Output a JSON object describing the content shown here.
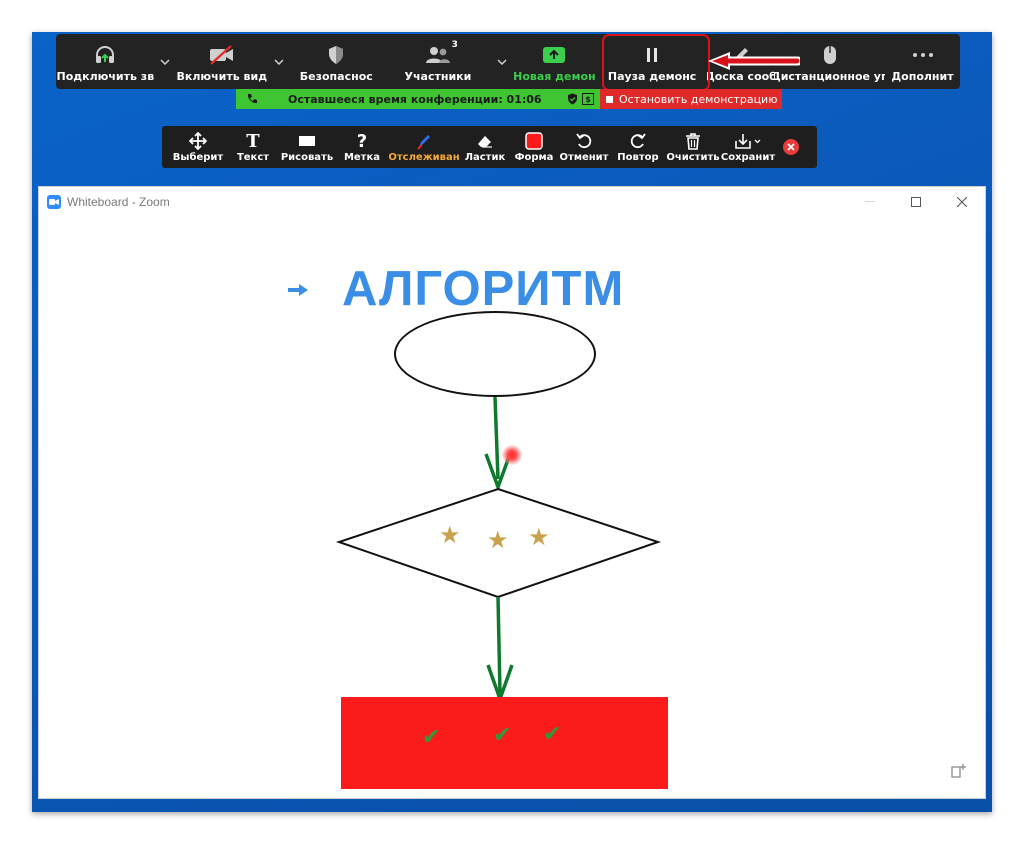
{
  "meeting_bar": {
    "items": [
      {
        "label": "Подключить зв",
        "icon": "headphones-icon"
      },
      {
        "label": "Включить вид",
        "icon": "video-off-icon"
      },
      {
        "label": "Безопаснос",
        "icon": "shield-icon"
      },
      {
        "label": "Участники",
        "icon": "participants-icon",
        "count": "3"
      },
      {
        "label": "Новая демон",
        "icon": "share-screen-icon"
      },
      {
        "label": "Пауза демонс",
        "icon": "pause-icon"
      },
      {
        "label": "Доска сооб",
        "icon": "pencil-icon"
      },
      {
        "label": "Дистанционное уп",
        "icon": "mouse-icon"
      },
      {
        "label": "Дополнит",
        "icon": "more-icon"
      }
    ]
  },
  "status": {
    "remaining_label": "Оставшееся время конференции: 01:06",
    "stop_share_label": "Остановить демонстрацию"
  },
  "annotation_toolbar": {
    "items": [
      {
        "label": "Выберит",
        "icon": "move-icon"
      },
      {
        "label": "Текст",
        "icon": "text-icon"
      },
      {
        "label": "Рисовать",
        "icon": "draw-rect-icon"
      },
      {
        "label": "Метка",
        "icon": "question-icon"
      },
      {
        "label": "Отслеживан",
        "icon": "spotlight-pen-icon",
        "active": true
      },
      {
        "label": "Ластик",
        "icon": "eraser-icon"
      },
      {
        "label": "Форма",
        "icon": "format-color-icon"
      },
      {
        "label": "Отменит",
        "icon": "undo-icon"
      },
      {
        "label": "Повтор",
        "icon": "redo-icon"
      },
      {
        "label": "Очистить",
        "icon": "trash-icon"
      },
      {
        "label": "Сохранит",
        "icon": "save-icon"
      }
    ]
  },
  "whiteboard": {
    "window_title": "Whiteboard - Zoom",
    "heading": "АЛГОРИТМ",
    "stars": [
      "★",
      "★",
      "★"
    ],
    "checks": [
      "✔",
      "✔",
      "✔"
    ]
  },
  "colors": {
    "accent_blue": "#3a8ee6",
    "green_status": "#3ec531",
    "stop_red": "#e02a2a",
    "highlight_red": "#d8131b",
    "arrow_green": "#0f7a2e",
    "box_red": "#fb1b1b"
  }
}
